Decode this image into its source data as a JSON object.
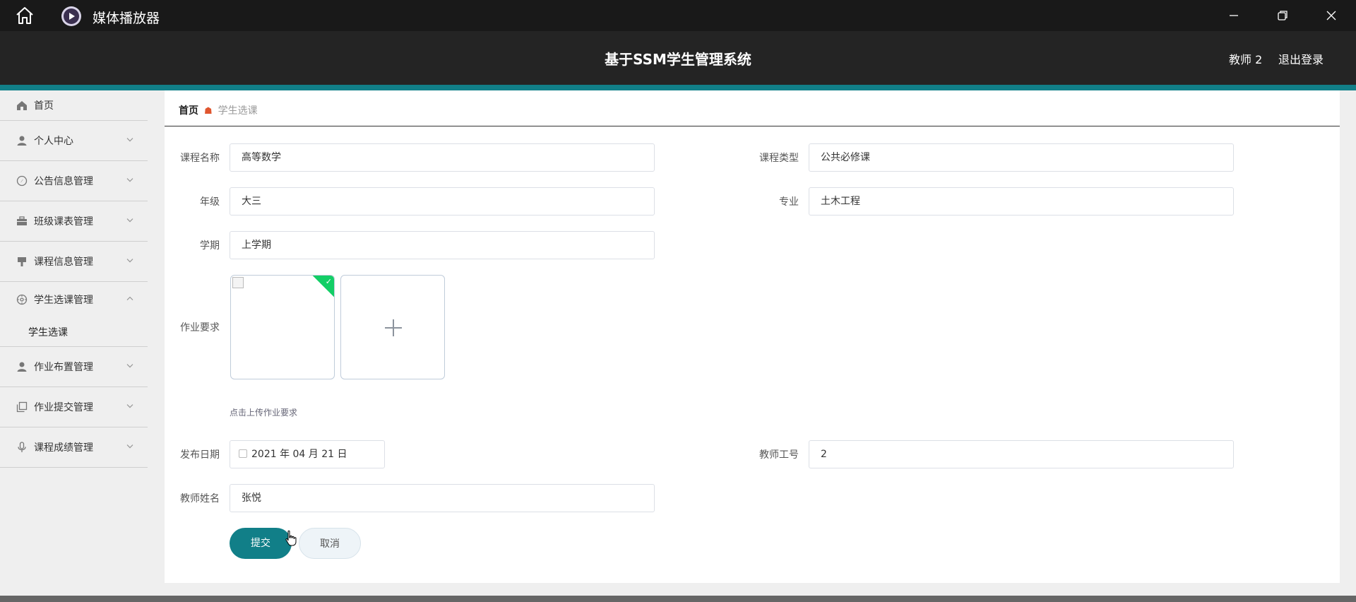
{
  "window": {
    "app_title": "媒体播放器",
    "icons": [
      "home-icon",
      "app-logo-icon",
      "minimize-icon",
      "maximize-icon",
      "close-icon"
    ]
  },
  "header": {
    "title": "基于SSM学生管理系统",
    "user": "教师 2",
    "logout": "退出登录"
  },
  "sidebar": {
    "items": [
      {
        "label": "首页",
        "icon": "home-icon"
      },
      {
        "label": "个人中心",
        "icon": "user-icon"
      },
      {
        "label": "公告信息管理",
        "icon": "compass-icon"
      },
      {
        "label": "班级课表管理",
        "icon": "briefcase-icon"
      },
      {
        "label": "课程信息管理",
        "icon": "brush-icon"
      },
      {
        "label": "学生选课管理",
        "icon": "target-icon",
        "expanded": true,
        "children": [
          "学生选课"
        ]
      },
      {
        "label": "作业布置管理",
        "icon": "user-icon"
      },
      {
        "label": "作业提交管理",
        "icon": "copy-icon"
      },
      {
        "label": "课程成绩管理",
        "icon": "microphone-icon"
      }
    ]
  },
  "breadcrumb": {
    "home": "首页",
    "current": "学生选课"
  },
  "form": {
    "course_name": {
      "label": "课程名称",
      "value": "高等数学"
    },
    "course_type": {
      "label": "课程类型",
      "value": "公共必修课"
    },
    "grade": {
      "label": "年级",
      "value": "大三"
    },
    "major": {
      "label": "专业",
      "value": "土木工程"
    },
    "semester": {
      "label": "学期",
      "value": "上学期"
    },
    "homework": {
      "label": "作业要求",
      "tip": "点击上传作业要求"
    },
    "publish_date": {
      "label": "发布日期",
      "value": "2021 年 04 月 21 日"
    },
    "teacher_id": {
      "label": "教师工号",
      "value": "2"
    },
    "teacher_name": {
      "label": "教师姓名",
      "value": "张悦"
    }
  },
  "buttons": {
    "submit": "提交",
    "cancel": "取消"
  },
  "colors": {
    "accent": "#117f88",
    "header_bg": "#242424",
    "titlebar_bg": "#191919",
    "upload_success": "#13ce66"
  }
}
